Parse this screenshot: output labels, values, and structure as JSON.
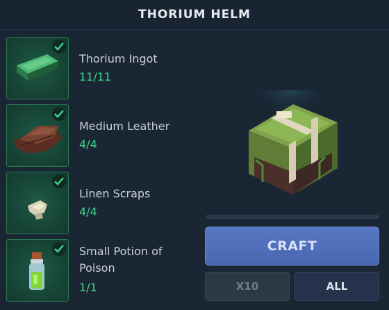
{
  "header": {
    "title": "THORIUM HELM"
  },
  "materials": [
    {
      "name": "Thorium Ingot",
      "count": "11/11",
      "icon": "thorium-ingot-icon"
    },
    {
      "name": "Medium Leather",
      "count": "4/4",
      "icon": "medium-leather-icon"
    },
    {
      "name": "Linen Scraps",
      "count": "4/4",
      "icon": "linen-scraps-icon"
    },
    {
      "name": "Small Potion of Poison",
      "count": "1/1",
      "icon": "small-potion-icon"
    }
  ],
  "actions": {
    "craft_label": "CRAFT",
    "x10_label": "X10",
    "all_label": "ALL"
  },
  "colors": {
    "count_green": "#3fd98a",
    "craft_blue": "#4a66b0",
    "slot_green": "#1f5a45"
  }
}
